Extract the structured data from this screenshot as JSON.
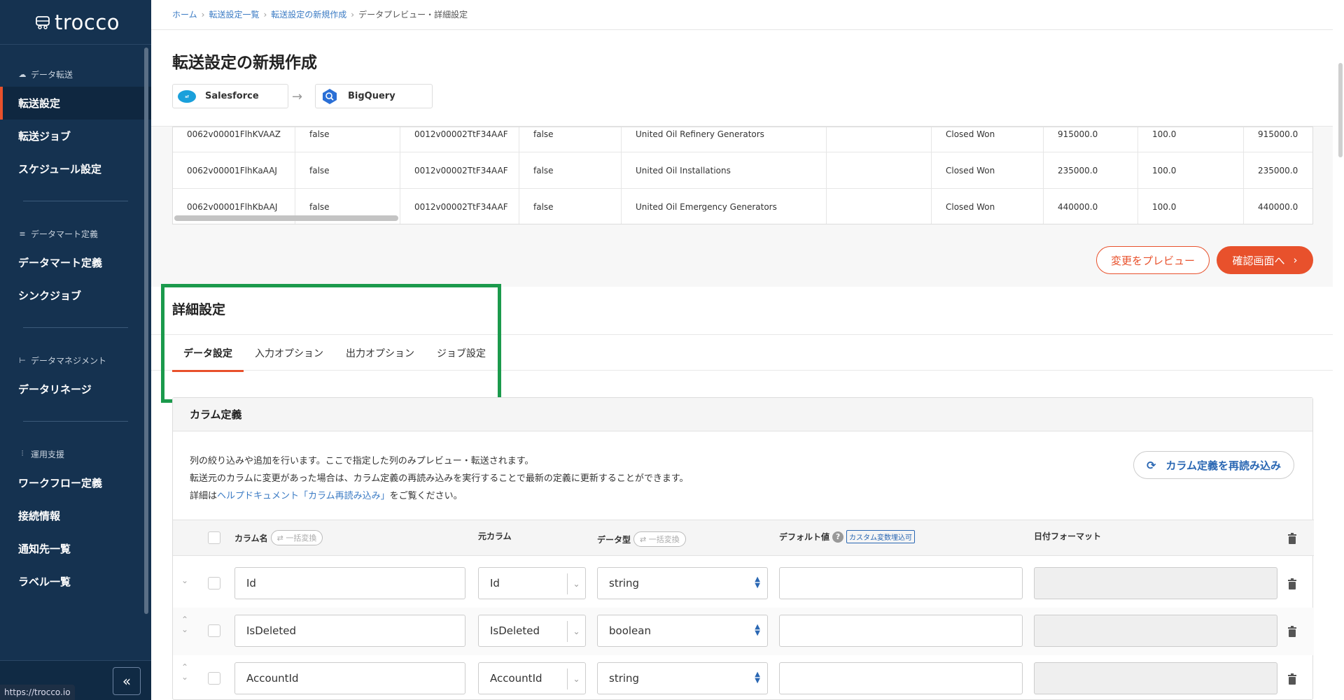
{
  "app": {
    "logo_text": "trocco",
    "status_url": "https://trocco.io"
  },
  "sidebar": {
    "sections": [
      {
        "title": "データ転送",
        "items": [
          "転送設定",
          "転送ジョブ",
          "スケジュール設定"
        ]
      },
      {
        "title": "データマート定義",
        "items": [
          "データマート定義",
          "シンクジョブ"
        ]
      },
      {
        "title": "データマネジメント",
        "items": [
          "データリネージ"
        ]
      },
      {
        "title": "運用支援",
        "items": [
          "ワークフロー定義",
          "接続情報",
          "通知先一覧",
          "ラベル一覧"
        ]
      }
    ],
    "active_item": "転送設定"
  },
  "breadcrumb": {
    "home": "ホーム",
    "list": "転送設定一覧",
    "new": "転送設定の新規作成",
    "current": "データプレビュー・詳細設定"
  },
  "page_title": "転送設定の新規作成",
  "connection": {
    "source": "Salesforce",
    "destination": "BigQuery"
  },
  "preview_rows": [
    [
      "0062v00001FlhKVAAZ",
      "false",
      "0012v00002TtF34AAF",
      "false",
      "United Oil Refinery Generators",
      "",
      "Closed Won",
      "915000.0",
      "100.0",
      "915000.0"
    ],
    [
      "0062v00001FlhKaAAJ",
      "false",
      "0012v00002TtF34AAF",
      "false",
      "United Oil Installations",
      "",
      "Closed Won",
      "235000.0",
      "100.0",
      "235000.0"
    ],
    [
      "0062v00001FlhKbAAJ",
      "false",
      "0012v00002TtF34AAF",
      "false",
      "United Oil Emergency Generators",
      "",
      "Closed Won",
      "440000.0",
      "100.0",
      "440000.0"
    ]
  ],
  "actions": {
    "preview": "変更をプレビュー",
    "confirm": "確認画面へ"
  },
  "detail": {
    "title": "詳細設定",
    "tabs": [
      "データ設定",
      "入力オプション",
      "出力オプション",
      "ジョブ設定"
    ],
    "active_tab": "データ設定"
  },
  "column_def": {
    "title": "カラム定義",
    "desc1": "列の絞り込みや追加を行います。ここで指定した列のみプレビュー・転送されます。",
    "desc2": "転送元のカラムに変更があった場合は、カラム定義の再読み込みを実行することで最新の定義に更新することができます。",
    "desc3_prefix": "詳細は",
    "desc3_link": "ヘルプドキュメント「カラム再読み込み」",
    "desc3_suffix": "をご覧ください。",
    "reload_button": "カラム定義を再読み込み",
    "headers": {
      "column_name": "カラム名",
      "bulk_convert": "一括変換",
      "source_column": "元カラム",
      "data_type": "データ型",
      "default_value": "デフォルト値",
      "custom_var": "カスタム変数埋込可",
      "date_format": "日付フォーマット"
    },
    "rows": [
      {
        "name": "Id",
        "source": "Id",
        "type": "string"
      },
      {
        "name": "IsDeleted",
        "source": "IsDeleted",
        "type": "boolean"
      },
      {
        "name": "AccountId",
        "source": "AccountId",
        "type": "string"
      }
    ]
  },
  "colors": {
    "sidebar": "#153250",
    "accent": "#e8512c",
    "highlight": "#1b9a4c",
    "link": "#3b7bc4"
  }
}
